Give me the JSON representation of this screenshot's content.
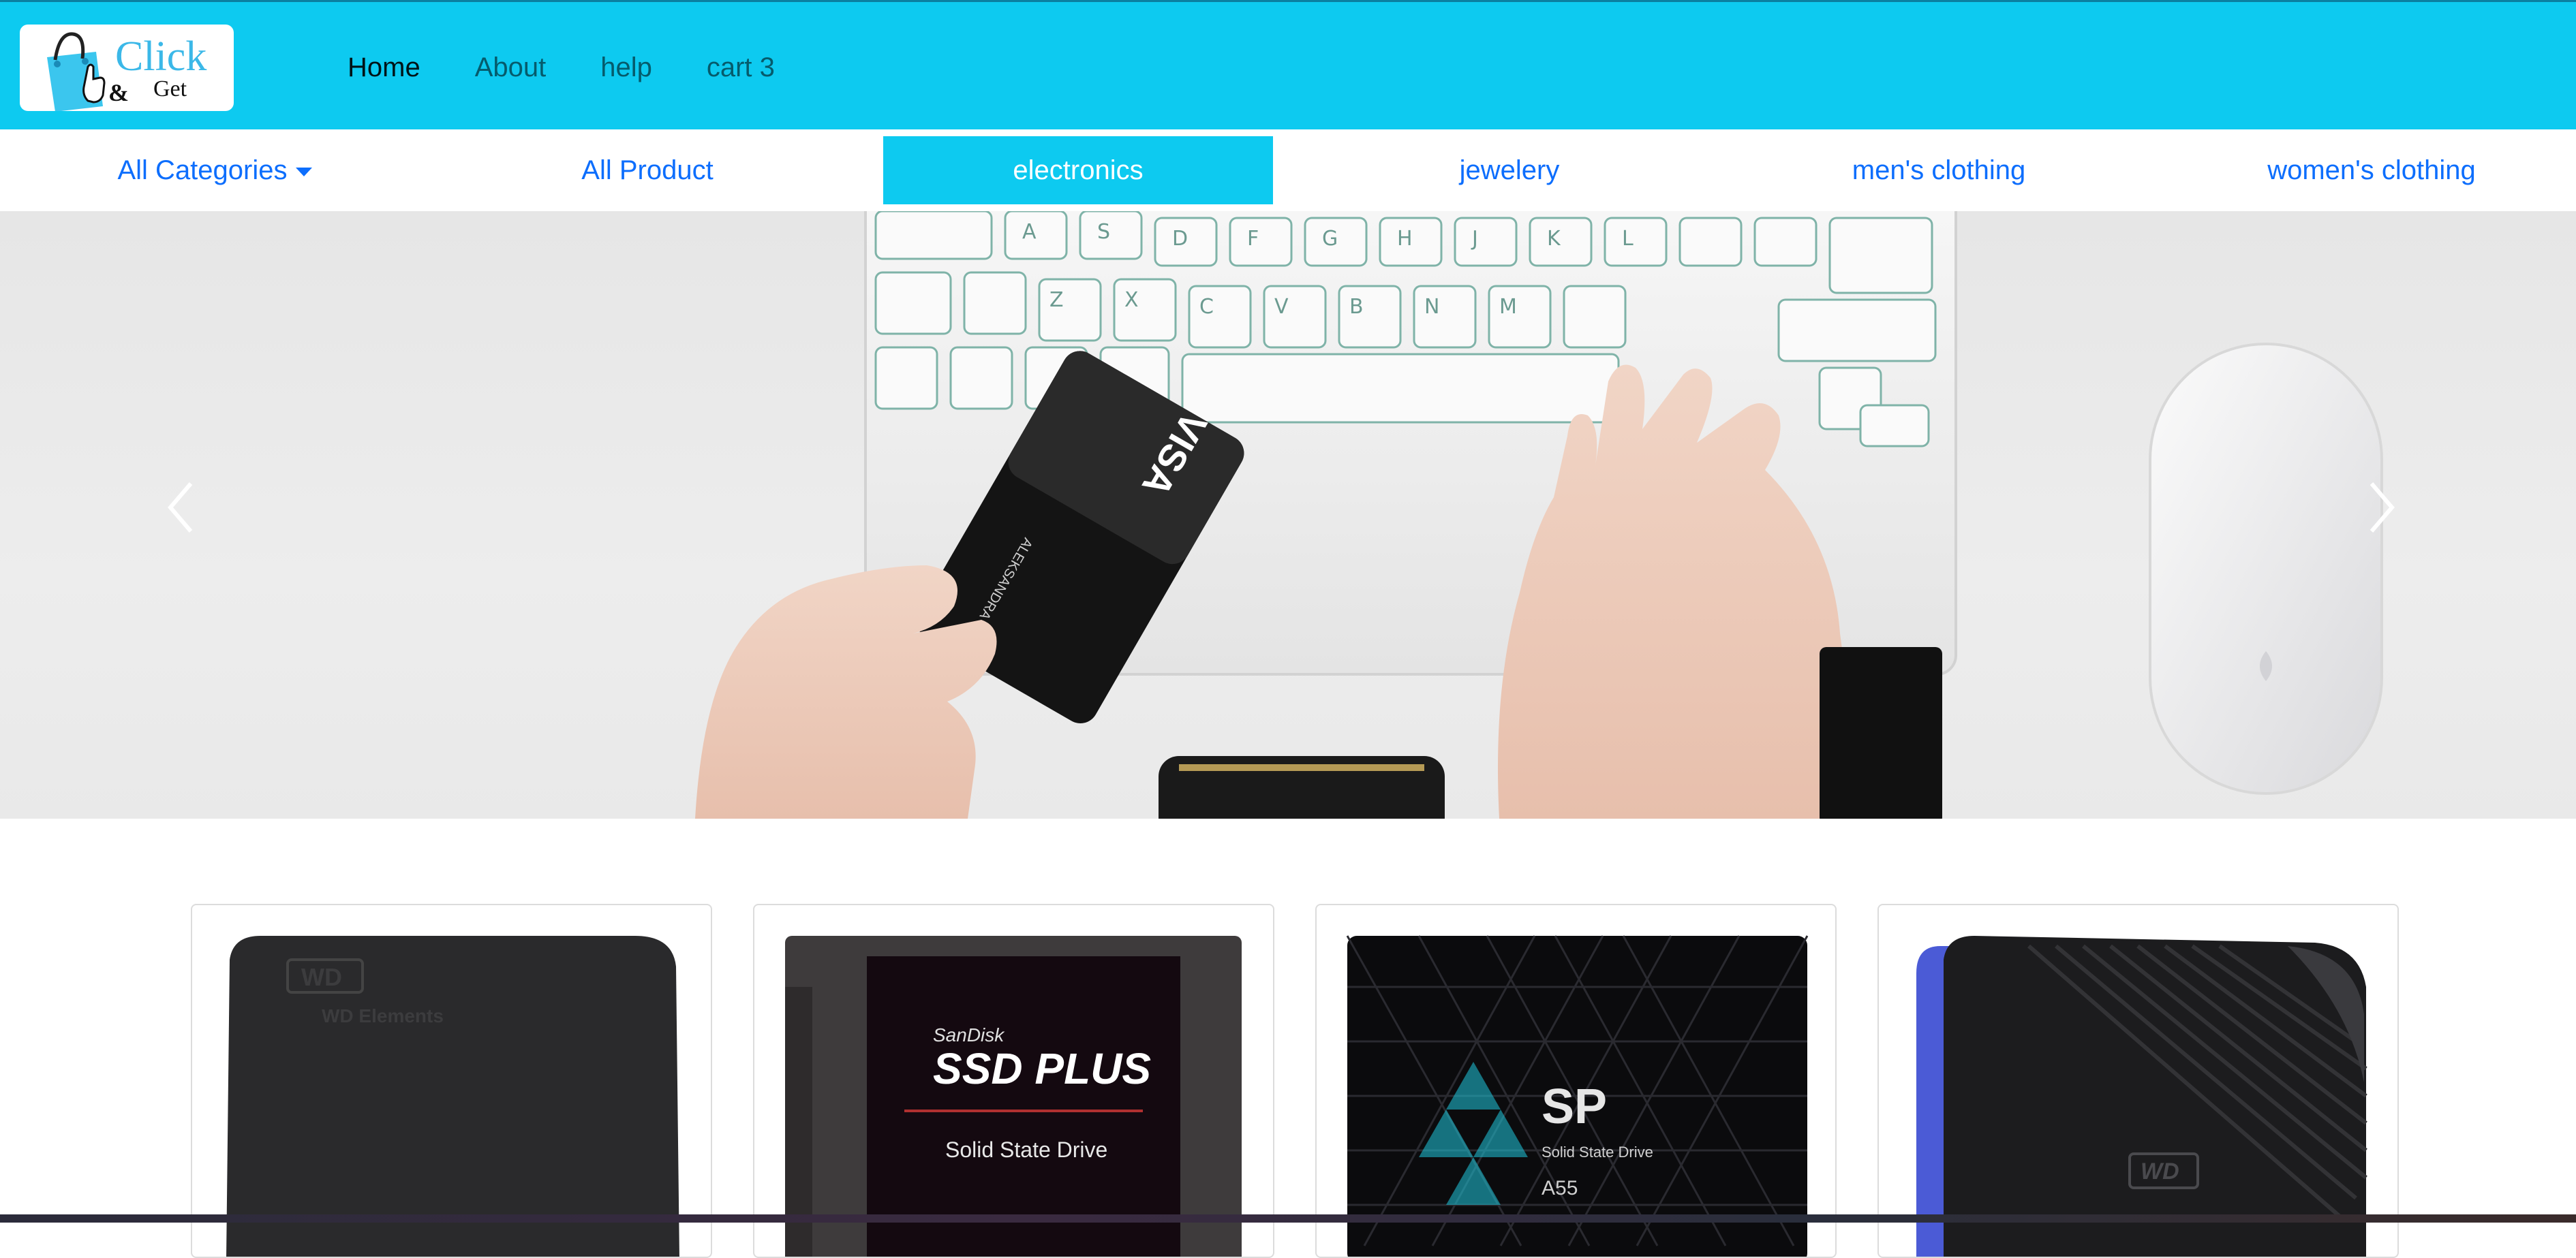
{
  "brand": {
    "logo_word1": "Click",
    "logo_amp": "&",
    "logo_word2": "Get",
    "accent_color": "#0dcaf0",
    "link_color": "#0d6efd"
  },
  "nav": {
    "items": [
      {
        "label": "Home",
        "active": true
      },
      {
        "label": "About",
        "active": false
      },
      {
        "label": "help",
        "active": false
      },
      {
        "label": "cart 3",
        "active": false
      }
    ]
  },
  "categories": {
    "dropdown_label": "All Categories",
    "items": [
      {
        "label": "All Product",
        "selected": false
      },
      {
        "label": "electronics",
        "selected": true
      },
      {
        "label": "jewelery",
        "selected": false
      },
      {
        "label": "men's clothing",
        "selected": false
      },
      {
        "label": "women's clothing",
        "selected": false
      }
    ]
  },
  "hero": {
    "image_name": "keyboard-card-payment-photo",
    "prev_icon": "chevron-left-icon",
    "next_icon": "chevron-right-icon",
    "card_brand": "VISA",
    "card_holder": "ALEKSANDRA TISHKOVA"
  },
  "products": [
    {
      "image_name": "wd-elements-drive-photo",
      "brand_text": "WD",
      "model_text": "WD Elements"
    },
    {
      "image_name": "sandisk-ssd-plus-photo",
      "brand_text": "SanDisk",
      "model_text": "SSD PLUS",
      "sub_text": "Solid State Drive"
    },
    {
      "image_name": "silicon-power-a55-photo",
      "brand_text": "SP",
      "model_text": "Solid State Drive",
      "sub_text": "A55"
    },
    {
      "image_name": "wd-gaming-drive-photo",
      "brand_text": "WD"
    }
  ]
}
